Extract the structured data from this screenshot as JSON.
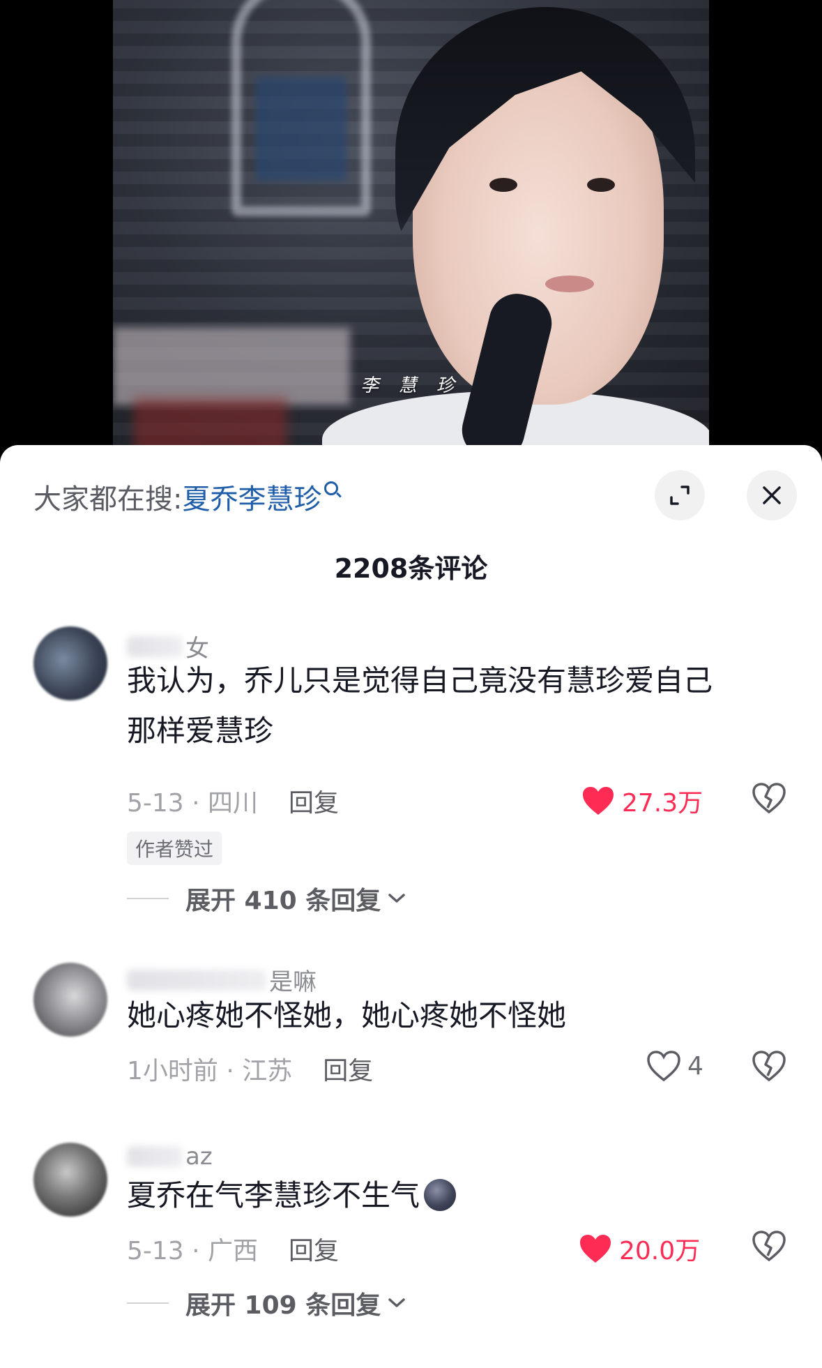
{
  "video": {
    "subtitle": "李 慧 珍"
  },
  "search": {
    "prefix": "大家都在搜:",
    "term": "夏乔李慧珍"
  },
  "comments_header": {
    "count_label": "2208条评论"
  },
  "comments": [
    {
      "username_visible": "女",
      "text_line1": "我认为，乔儿只是觉得自己竟没有慧珍爱自己",
      "text_line2": "那样爱慧珍",
      "meta": "5-13 · 四川",
      "reply_label": "回复",
      "likes": "27.3万",
      "liked": true,
      "author_badge": "作者赞过",
      "expand_label": "展开 410 条回复"
    },
    {
      "username_visible": "是嘛",
      "text_line1": "她心疼她不怪她，她心疼她不怪她",
      "meta": "1小时前 · 江苏",
      "reply_label": "回复",
      "likes": "4",
      "liked": false
    },
    {
      "username_visible": "az",
      "text_line1": "夏乔在气李慧珍不生气",
      "meta": "5-13 · 广西",
      "reply_label": "回复",
      "likes": "20.0万",
      "liked": true,
      "expand_label": "展开 109 条回复"
    }
  ],
  "colors": {
    "like_red": "#fe2c55",
    "search_link_blue": "#1f5da8",
    "text_dark": "#161823",
    "text_gray": "#a1a2a7"
  },
  "icons": {
    "expand": "expand-icon",
    "close": "close-icon",
    "search": "search-icon",
    "heart": "heart-icon",
    "dislike": "broken-heart-icon",
    "chevron": "chevron-down-icon",
    "emoji": "moon-face-emoji"
  }
}
